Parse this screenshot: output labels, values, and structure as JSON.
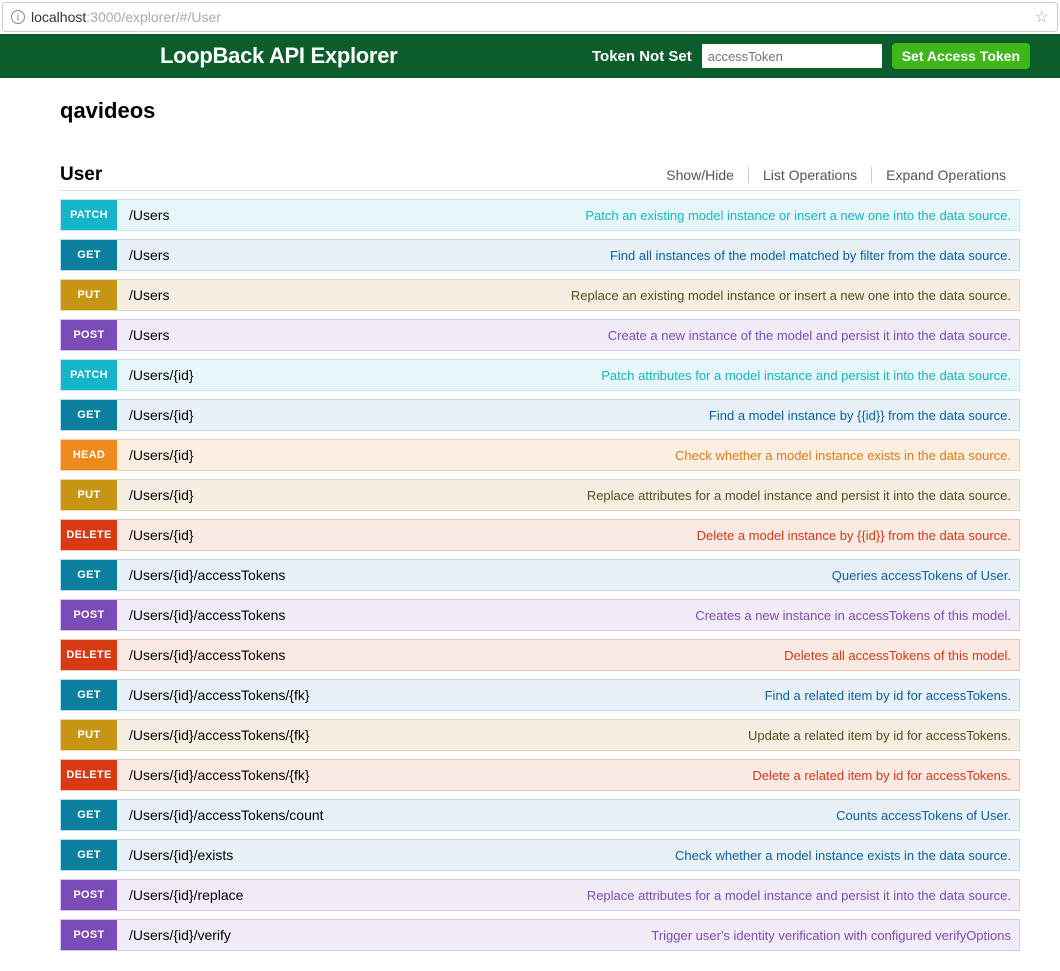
{
  "browser": {
    "host": "localhost",
    "rest": ":3000/explorer/#/User"
  },
  "header": {
    "title": "LoopBack API Explorer",
    "token_label": "Token Not Set",
    "token_placeholder": "accessToken",
    "set_btn": "Set Access Token"
  },
  "api_title": "qavideos",
  "resource": {
    "name": "User",
    "ops": {
      "showhide": "Show/Hide",
      "list": "List Operations",
      "expand": "Expand Operations"
    }
  },
  "operations": [
    {
      "verb": "PATCH",
      "cls": "v-patch",
      "path": "/Users",
      "desc": "Patch an existing model instance or insert a new one into the data source."
    },
    {
      "verb": "GET",
      "cls": "v-get",
      "path": "/Users",
      "desc": "Find all instances of the model matched by filter from the data source."
    },
    {
      "verb": "PUT",
      "cls": "v-put",
      "path": "/Users",
      "desc": "Replace an existing model instance or insert a new one into the data source."
    },
    {
      "verb": "POST",
      "cls": "v-post",
      "path": "/Users",
      "desc": "Create a new instance of the model and persist it into the data source."
    },
    {
      "verb": "PATCH",
      "cls": "v-patch",
      "path": "/Users/{id}",
      "desc": "Patch attributes for a model instance and persist it into the data source."
    },
    {
      "verb": "GET",
      "cls": "v-get",
      "path": "/Users/{id}",
      "desc": "Find a model instance by {{id}} from the data source."
    },
    {
      "verb": "HEAD",
      "cls": "v-head",
      "path": "/Users/{id}",
      "desc": "Check whether a model instance exists in the data source."
    },
    {
      "verb": "PUT",
      "cls": "v-put",
      "path": "/Users/{id}",
      "desc": "Replace attributes for a model instance and persist it into the data source."
    },
    {
      "verb": "DELETE",
      "cls": "v-delete",
      "path": "/Users/{id}",
      "desc": "Delete a model instance by {{id}} from the data source."
    },
    {
      "verb": "GET",
      "cls": "v-get",
      "path": "/Users/{id}/accessTokens",
      "desc": "Queries accessTokens of User."
    },
    {
      "verb": "POST",
      "cls": "v-post",
      "path": "/Users/{id}/accessTokens",
      "desc": "Creates a new instance in accessTokens of this model."
    },
    {
      "verb": "DELETE",
      "cls": "v-delete",
      "path": "/Users/{id}/accessTokens",
      "desc": "Deletes all accessTokens of this model."
    },
    {
      "verb": "GET",
      "cls": "v-get",
      "path": "/Users/{id}/accessTokens/{fk}",
      "desc": "Find a related item by id for accessTokens."
    },
    {
      "verb": "PUT",
      "cls": "v-put",
      "path": "/Users/{id}/accessTokens/{fk}",
      "desc": "Update a related item by id for accessTokens."
    },
    {
      "verb": "DELETE",
      "cls": "v-delete",
      "path": "/Users/{id}/accessTokens/{fk}",
      "desc": "Delete a related item by id for accessTokens."
    },
    {
      "verb": "GET",
      "cls": "v-get",
      "path": "/Users/{id}/accessTokens/count",
      "desc": "Counts accessTokens of User."
    },
    {
      "verb": "GET",
      "cls": "v-get",
      "path": "/Users/{id}/exists",
      "desc": "Check whether a model instance exists in the data source."
    },
    {
      "verb": "POST",
      "cls": "v-post",
      "path": "/Users/{id}/replace",
      "desc": "Replace attributes for a model instance and persist it into the data source."
    },
    {
      "verb": "POST",
      "cls": "v-post",
      "path": "/Users/{id}/verify",
      "desc": "Trigger user's identity verification with configured verifyOptions"
    }
  ]
}
